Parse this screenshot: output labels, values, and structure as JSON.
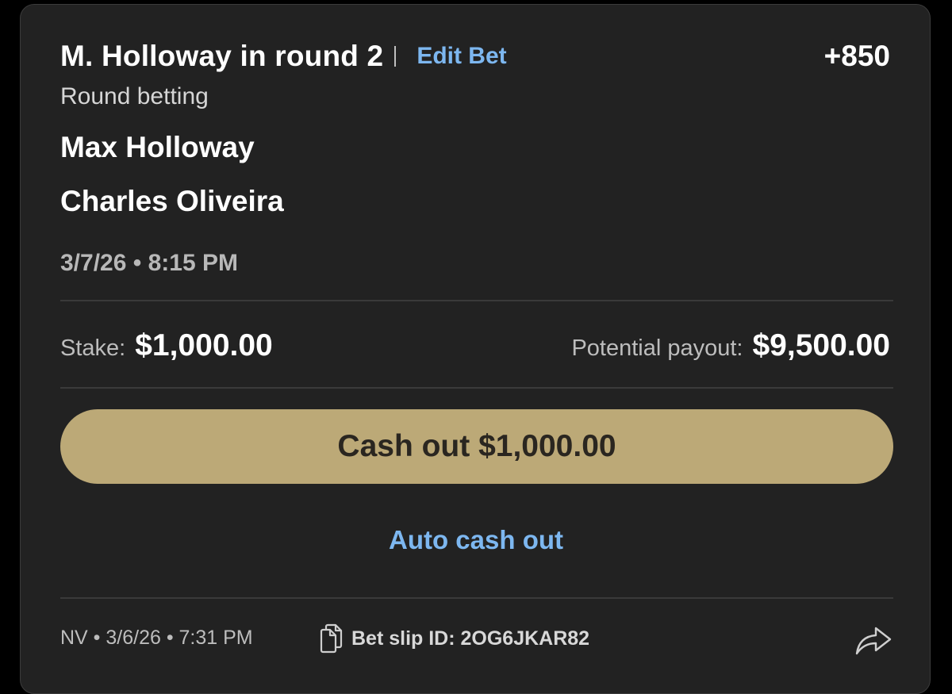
{
  "bet": {
    "title": "M. Holloway in round 2",
    "edit_label": "Edit Bet",
    "odds": "+850",
    "market": "Round betting",
    "fighters": [
      "Max Holloway",
      "Charles Oliveira"
    ],
    "event_time": "3/7/26 • 8:15 PM"
  },
  "wager": {
    "stake_label": "Stake:",
    "stake_value": "$1,000.00",
    "payout_label": "Potential payout:",
    "payout_value": "$9,500.00"
  },
  "actions": {
    "cashout_label": "Cash out $1,000.00",
    "auto_cashout_label": "Auto cash out"
  },
  "footer": {
    "placed": "NV • 3/6/26 • 7:31 PM",
    "slip_id": "Bet slip ID: 2OG6JKAR82"
  },
  "icons": {
    "slip": "copy-icon",
    "share": "share-arrow-icon"
  },
  "colors": {
    "card_bg": "#222222",
    "accent_link": "#7db7f0",
    "cashout_button": "#bca977"
  }
}
